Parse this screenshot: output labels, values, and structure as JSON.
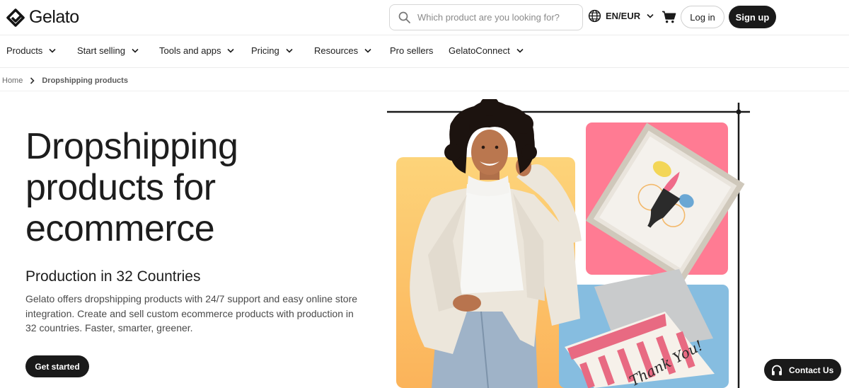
{
  "brand": {
    "name": "Gelato"
  },
  "search": {
    "placeholder": "Which product are you looking for?"
  },
  "header": {
    "language": "EN/EUR",
    "login_label": "Log in",
    "signup_label": "Sign up"
  },
  "nav": {
    "items": [
      {
        "label": "Products",
        "has_dropdown": true
      },
      {
        "label": "Start selling",
        "has_dropdown": true
      },
      {
        "label": "Tools and apps",
        "has_dropdown": true
      },
      {
        "label": "Pricing",
        "has_dropdown": true
      },
      {
        "label": "Resources",
        "has_dropdown": true
      },
      {
        "label": "Pro sellers",
        "has_dropdown": false
      },
      {
        "label": "GelatoConnect",
        "has_dropdown": true
      }
    ]
  },
  "breadcrumb": {
    "home": "Home",
    "current": "Dropshipping products"
  },
  "hero": {
    "title_line1": "Dropshipping",
    "title_line2": "products for",
    "title_line3": "ecommerce",
    "subtitle": "Production in 32 Countries",
    "description": "Gelato offers dropshipping products with 24/7 support and easy online store integration. Create and sell custom ecommerce products with production in 32 countries. Faster, smarter, greener.",
    "cta_label": "Get started",
    "card_text": "Thank You!"
  },
  "contact": {
    "label": "Contact Us"
  },
  "colors": {
    "dark": "#1a1a1a",
    "yellow_panel": "#fccf6b",
    "pink_panel": "#ff7b93",
    "blue_panel": "#86bde0"
  }
}
